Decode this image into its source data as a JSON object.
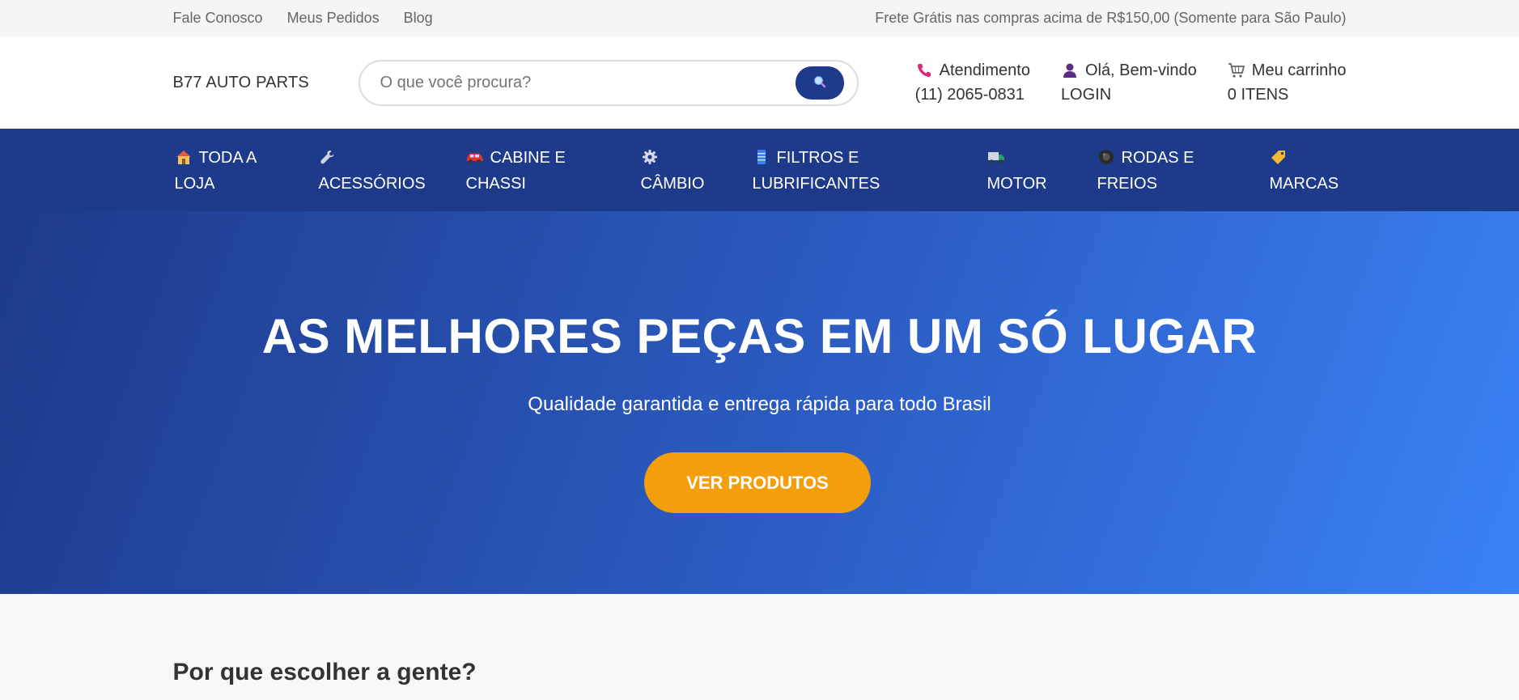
{
  "topbar": {
    "links": [
      "Fale Conosco",
      "Meus Pedidos",
      "Blog"
    ],
    "promo": "Frete Grátis nas compras acima de R$150,00 (Somente para São Paulo)"
  },
  "header": {
    "logo": "B77 AUTO PARTS",
    "search_placeholder": "O que você procura?",
    "search_icon": "magnifier-icon",
    "support": {
      "label": "Atendimento",
      "value": "(11) 2065-0831",
      "icon": "phone-icon"
    },
    "account": {
      "label": "Olá, Bem-vindo",
      "value": "LOGIN",
      "icon": "user-icon"
    },
    "cart": {
      "label": "Meu carrinho",
      "value": "0 ITENS",
      "icon": "cart-icon"
    }
  },
  "nav": {
    "items": [
      {
        "line1": "TODA A",
        "line2": "LOJA",
        "icon": "house-icon"
      },
      {
        "line1": "",
        "line2": "ACESSÓRIOS",
        "icon": "wrench-icon"
      },
      {
        "line1": "CABINE E",
        "line2": "CHASSI",
        "icon": "car-icon"
      },
      {
        "line1": "",
        "line2": "CÂMBIO",
        "icon": "gear-icon"
      },
      {
        "line1": "FILTROS E",
        "line2": "LUBRIFICANTES",
        "icon": "filter-icon"
      },
      {
        "line1": "",
        "line2": "MOTOR",
        "icon": "truck-icon"
      },
      {
        "line1": "RODAS E",
        "line2": "FREIOS",
        "icon": "wheel-icon"
      },
      {
        "line1": "",
        "line2": "MARCAS",
        "icon": "tag-icon"
      }
    ]
  },
  "hero": {
    "title": "AS MELHORES PEÇAS EM UM SÓ LUGAR",
    "subtitle": "Qualidade garantida e entrega rápida para todo Brasil",
    "cta": "VER PRODUTOS"
  },
  "why": {
    "title": "Por que escolher a gente?"
  },
  "colors": {
    "primary": "#1e3a8a",
    "hero_end": "#3b82f6",
    "accent": "#f59e0b",
    "topbar_bg": "#f5f5f5"
  }
}
